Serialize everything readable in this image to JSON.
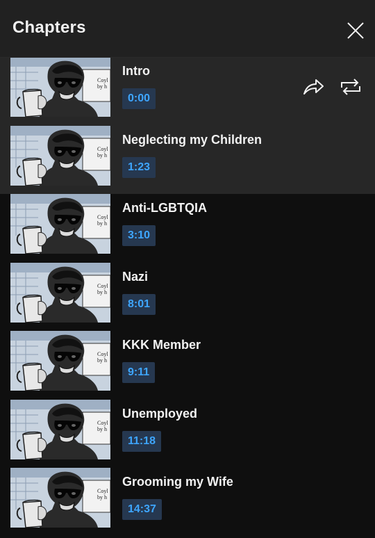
{
  "header": {
    "title": "Chapters"
  },
  "chapters": [
    {
      "title": "Intro",
      "time": "0:00"
    },
    {
      "title": "Neglecting my Children",
      "time": "1:23"
    },
    {
      "title": "Anti-LGBTQIA",
      "time": "3:10"
    },
    {
      "title": "Nazi",
      "time": "8:01"
    },
    {
      "title": "KKK Member",
      "time": "9:11"
    },
    {
      "title": "Unemployed",
      "time": "11:18"
    },
    {
      "title": "Grooming my Wife",
      "time": "14:37"
    }
  ],
  "thumbnail_text": {
    "line1": "Coyl",
    "line2": "by h"
  },
  "icons": {
    "close": "close-icon",
    "share": "share-icon",
    "loop": "loop-icon"
  },
  "colors": {
    "time_text": "#3ea6ff",
    "time_bg": "#263850",
    "highlight": "#272727",
    "header": "#212121"
  }
}
